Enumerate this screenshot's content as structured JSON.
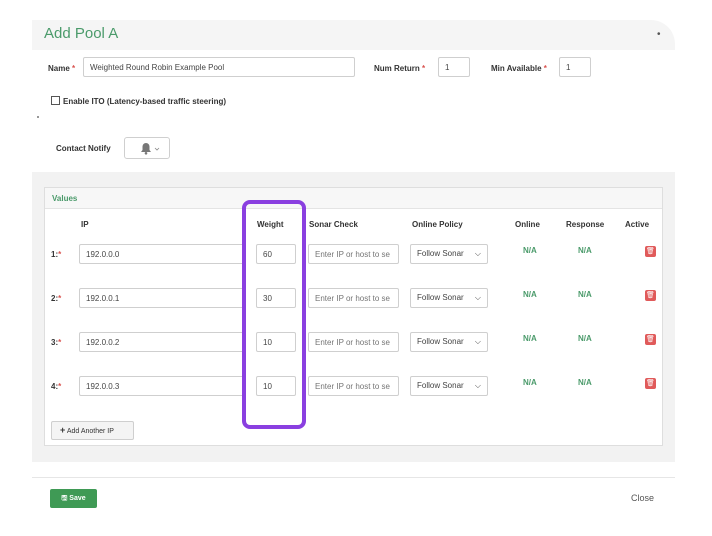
{
  "modal": {
    "title": "Add Pool A",
    "close_label": "Close",
    "save_label": "Save"
  },
  "form": {
    "name_label": "Name",
    "name_value": "Weighted Round Robin Example Pool",
    "num_return_label": "Num Return",
    "num_return_value": "1",
    "min_available_label": "Min Available",
    "min_available_value": "1",
    "ito_label": "Enable ITO (Latency-based traffic steering)",
    "ito_checked": false,
    "contact_notify_label": "Contact Notify",
    "required_mark": "*"
  },
  "values": {
    "section_title": "Values",
    "columns": {
      "ip": "IP",
      "weight": "Weight",
      "sonar": "Sonar Check",
      "policy": "Online Policy",
      "online": "Online",
      "response": "Response",
      "active": "Active"
    },
    "sonar_placeholder": "Enter IP or host to se",
    "rows": [
      {
        "label": "1:",
        "ip": "192.0.0.0",
        "weight": "60",
        "policy": "Follow Sonar",
        "online": "N/A",
        "response": "N/A"
      },
      {
        "label": "2:",
        "ip": "192.0.0.1",
        "weight": "30",
        "policy": "Follow Sonar",
        "online": "N/A",
        "response": "N/A"
      },
      {
        "label": "3:",
        "ip": "192.0.0.2",
        "weight": "10",
        "policy": "Follow Sonar",
        "online": "N/A",
        "response": "N/A"
      },
      {
        "label": "4:",
        "ip": "192.0.0.3",
        "weight": "10",
        "policy": "Follow Sonar",
        "online": "N/A",
        "response": "N/A"
      }
    ],
    "add_button_label": "Add Another IP"
  },
  "colors": {
    "accent_green": "#4a9a6a",
    "highlight_purple": "#8a3fe0",
    "delete_red": "#e05a5a"
  }
}
